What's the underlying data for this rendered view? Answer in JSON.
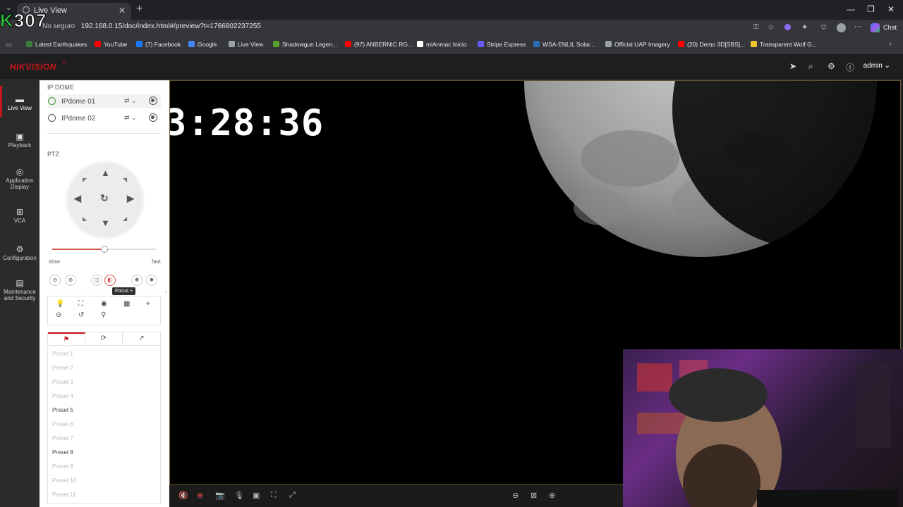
{
  "browser": {
    "tab_title": "Live View",
    "url_security": "No seguro",
    "url": "192.168.0.15/doc/index.html#/preview?t=1766802237255",
    "chat_label": "Chat",
    "bookmarks": [
      {
        "label": "Latest Earthquakes",
        "color": "#3b7d3b"
      },
      {
        "label": "YouTube",
        "color": "#ff0000"
      },
      {
        "label": "(7) Facebook",
        "color": "#1877f2"
      },
      {
        "label": "Google",
        "color": "#4285f4"
      },
      {
        "label": "Live View",
        "color": "#9aa0a6"
      },
      {
        "label": "Shadowgun Legen...",
        "color": "#5aa02c"
      },
      {
        "label": "(97) ANBERNIC RG...",
        "color": "#ff0000"
      },
      {
        "label": "miAnmac Inicio",
        "color": "#ffffff"
      },
      {
        "label": "Stripe Express",
        "color": "#635bff"
      },
      {
        "label": "WSA-ENLIL Solar...",
        "color": "#2a6fb5"
      },
      {
        "label": "Official UAP Imagery",
        "color": "#9aa0a6"
      },
      {
        "label": "(20) Demo 3D[SBS]...",
        "color": "#ff0000"
      },
      {
        "label": "Transparent Wolf G...",
        "color": "#f1c232"
      }
    ]
  },
  "overlay_badge": {
    "letter": "K",
    "number": "307"
  },
  "app": {
    "brand": "HIKVISION",
    "user": "admin"
  },
  "nav": [
    {
      "label": "Live View",
      "icon": "live-view-icon"
    },
    {
      "label": "Playback",
      "icon": "playback-icon"
    },
    {
      "label": "Application Display",
      "icon": "application-icon"
    },
    {
      "label": "VCA",
      "icon": "vca-icon"
    },
    {
      "label": "Configuration",
      "icon": "gear-icon"
    },
    {
      "label": "Maintenance and Security",
      "icon": "maintenance-icon"
    }
  ],
  "devices": {
    "group": "IP DOME",
    "items": [
      {
        "label": "IPdome 01",
        "selected": true
      },
      {
        "label": "IPdome 02",
        "selected": false
      }
    ]
  },
  "ptz": {
    "label": "PTZ",
    "speed_slow": "slow",
    "speed_fast": "fast",
    "speed_value": 0.5,
    "tooltip": "Focus +"
  },
  "presets": [
    {
      "label": "Preset 1",
      "set": false
    },
    {
      "label": "Preset 2",
      "set": false
    },
    {
      "label": "Preset 3",
      "set": false
    },
    {
      "label": "Preset 4",
      "set": false
    },
    {
      "label": "Preset 5",
      "set": true
    },
    {
      "label": "Preset 6",
      "set": false
    },
    {
      "label": "Preset 7",
      "set": false
    },
    {
      "label": "Preset 8",
      "set": true
    },
    {
      "label": "Preset 9",
      "set": false
    },
    {
      "label": "Preset 10",
      "set": false
    },
    {
      "label": "Preset 11",
      "set": false
    }
  ],
  "video": {
    "clock": "3:28:36"
  }
}
